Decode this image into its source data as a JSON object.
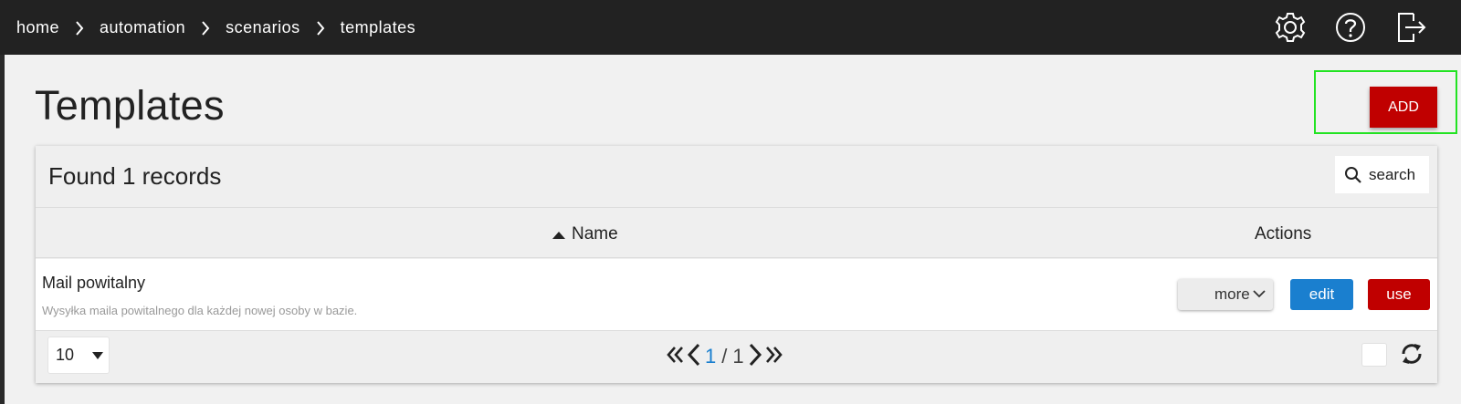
{
  "breadcrumb": {
    "items": [
      {
        "label": "home"
      },
      {
        "label": "automation"
      },
      {
        "label": "scenarios"
      },
      {
        "label": "templates"
      }
    ]
  },
  "topbar": {
    "icons": [
      "gear-icon",
      "help-icon",
      "logout-icon"
    ]
  },
  "page": {
    "title": "Templates",
    "add_label": "ADD"
  },
  "panel": {
    "found_text": "Found 1 records",
    "search_label": "search",
    "columns": {
      "name": "Name",
      "actions": "Actions"
    },
    "rows": [
      {
        "title": "Mail powitalny",
        "description": "Wysyłka maila powitalnego dla każdej nowej osoby w bazie.",
        "more_label": "more",
        "edit_label": "edit",
        "use_label": "use"
      }
    ],
    "footer": {
      "per_page": "10",
      "current_page": "1",
      "page_sep": "/",
      "total_pages": "1"
    }
  },
  "colors": {
    "topbar": "#222222",
    "brand_red": "#c00000",
    "edit_blue": "#1a7fcf",
    "highlight_green": "#22e322"
  }
}
